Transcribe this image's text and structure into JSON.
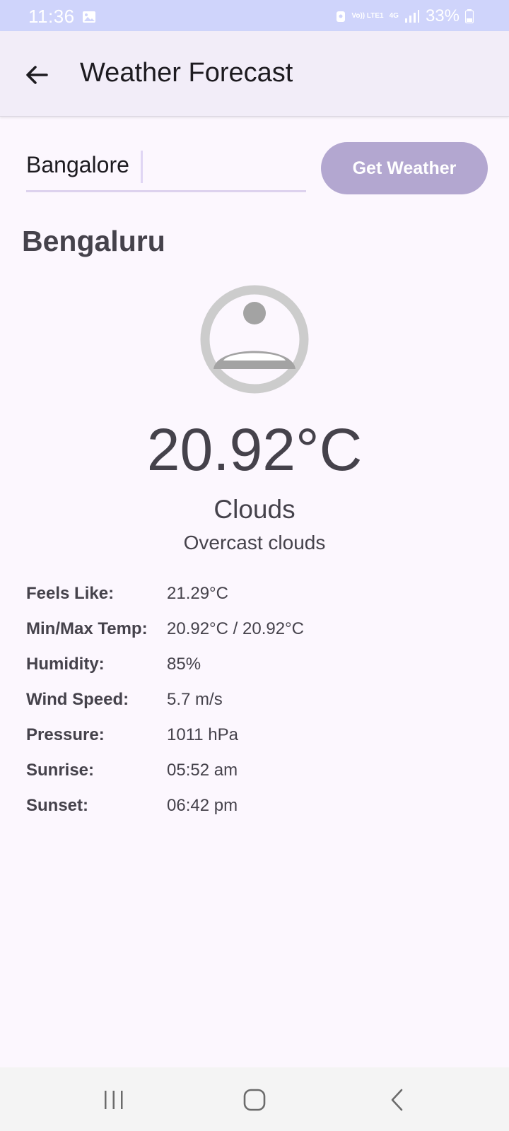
{
  "status_bar": {
    "time": "11:36",
    "network": "Vo)) LTE1",
    "network_type": "4G",
    "battery": "33%"
  },
  "app_bar": {
    "title": "Weather Forecast",
    "back_icon": "arrow-back-icon"
  },
  "search": {
    "city_value": "Bangalore",
    "button_label": "Get Weather"
  },
  "weather": {
    "city": "Bengaluru",
    "icon": "cloud-icon",
    "temperature": "20.92°C",
    "main": "Clouds",
    "description": "Overcast clouds"
  },
  "details": [
    {
      "label": "Feels Like:",
      "value": "21.29°C"
    },
    {
      "label": "Min/Max Temp:",
      "value": "20.92°C / 20.92°C"
    },
    {
      "label": "Humidity:",
      "value": "85%"
    },
    {
      "label": "Wind Speed:",
      "value": "5.7 m/s"
    },
    {
      "label": "Pressure:",
      "value": "1011 hPa"
    },
    {
      "label": "Sunrise:",
      "value": "05:52 am"
    },
    {
      "label": "Sunset:",
      "value": "06:42 pm"
    }
  ],
  "nav_bar": {
    "recent_icon": "recent-apps-icon",
    "home_icon": "home-icon",
    "back_icon": "back-icon"
  },
  "colors": {
    "status_bar": "#cfd4fb",
    "app_bar": "#f2edf8",
    "background": "#fcf7fe",
    "button": "#b3a7d0",
    "text": "#45424b"
  }
}
